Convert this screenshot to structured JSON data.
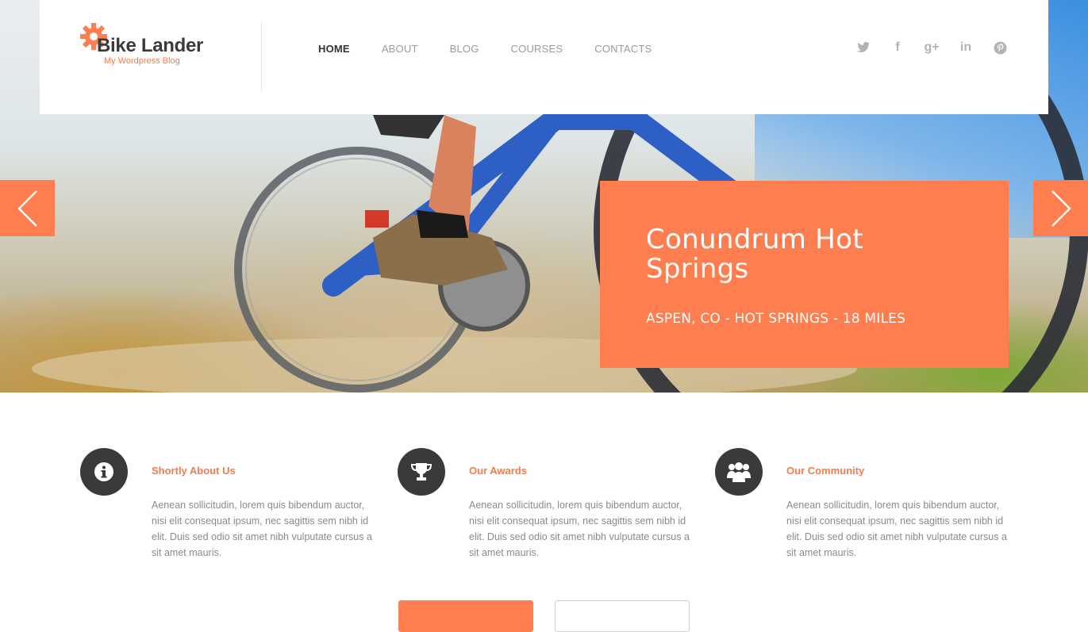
{
  "brand": {
    "name": "Bike Lander",
    "tagline": "My Wordpress Blog",
    "accent_color": "#ff7e4f"
  },
  "nav": {
    "items": [
      {
        "label": "HOME",
        "active": true
      },
      {
        "label": "ABOUT",
        "active": false
      },
      {
        "label": "BLOG",
        "active": false
      },
      {
        "label": "COURSES",
        "active": false
      },
      {
        "label": "CONTACTS",
        "active": false
      }
    ]
  },
  "social": {
    "icons": [
      "twitter-icon",
      "facebook-icon",
      "google-plus-icon",
      "linkedin-icon",
      "pinterest-icon"
    ],
    "glyphs": {
      "twitter": "t",
      "facebook": "f",
      "google_plus": "g+",
      "linkedin": "in",
      "pinterest": "p"
    }
  },
  "slider": {
    "title": "Conundrum Hot Springs",
    "subtitle": "ASPEN, CO - HOT SPRINGS - 18 MILES",
    "prev_icon": "chevron-left-icon",
    "next_icon": "chevron-right-icon"
  },
  "features": [
    {
      "icon": "info-icon",
      "title": "Shortly About Us",
      "text": "Aenean sollicitudin, lorem quis bibendum auctor, nisi elit consequat ipsum, nec sagittis sem nibh id elit. Duis sed odio sit amet nibh vulputate cursus a sit amet mauris."
    },
    {
      "icon": "trophy-icon",
      "title": "Our Awards",
      "text": "Aenean sollicitudin, lorem quis bibendum auctor, nisi elit consequat ipsum, nec sagittis sem nibh id elit. Duis sed odio sit amet nibh vulputate cursus a sit amet mauris."
    },
    {
      "icon": "community-icon",
      "title": "Our Community",
      "text": "Aenean sollicitudin, lorem quis bibendum auctor, nisi elit consequat ipsum, nec sagittis sem nibh id elit. Duis sed odio sit amet nibh vulputate cursus a sit amet mauris."
    }
  ],
  "buttons": {
    "primary_label": "",
    "secondary_label": ""
  }
}
